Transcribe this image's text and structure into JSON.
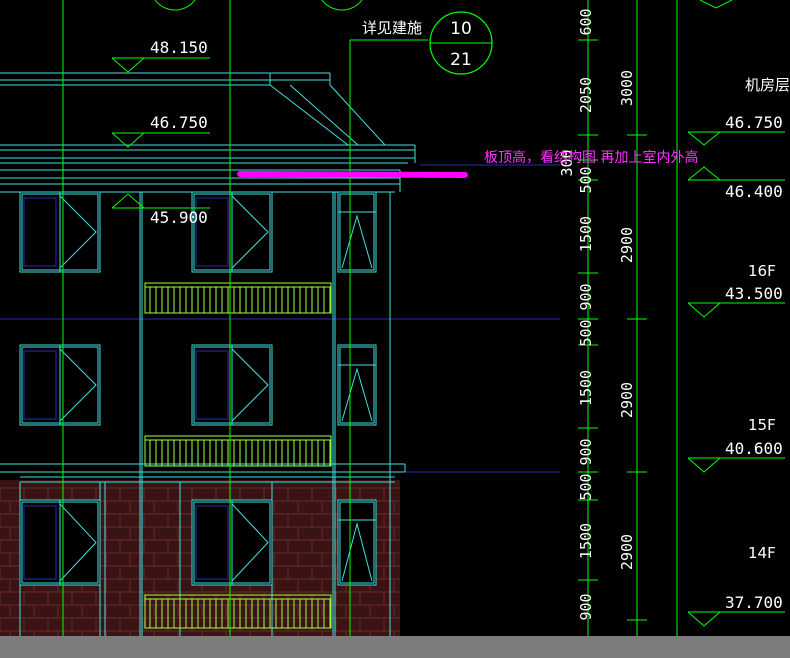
{
  "elevations": {
    "e48150": "48.150",
    "e46750_left": "46.750",
    "e45900": "45.900",
    "e46750_right": "46.750",
    "e46400": "46.400",
    "e43500": "43.500",
    "e40600": "40.600",
    "e37700": "37.700"
  },
  "floors": {
    "machine_room": "机房层",
    "f16": "16F",
    "f15": "15F",
    "f14": "14F"
  },
  "detail_ref": {
    "label": "详见建施",
    "top": "10",
    "bottom": "21"
  },
  "annotation": "板顶高，看结构图  再加上室内外高",
  "dimensions": {
    "inner": [
      "600",
      "2050",
      "300",
      "500",
      "1500",
      "900",
      "500",
      "1500",
      "900",
      "500",
      "1500",
      "900"
    ],
    "outer": [
      "3000",
      "2900",
      "2900",
      "2900"
    ]
  },
  "colors": {
    "green": "#00ff00",
    "cyan": "#40e0e0",
    "magenta": "#ff00ff",
    "blue_grid": "#1a1aa0",
    "brick": "#5a1e1e"
  }
}
